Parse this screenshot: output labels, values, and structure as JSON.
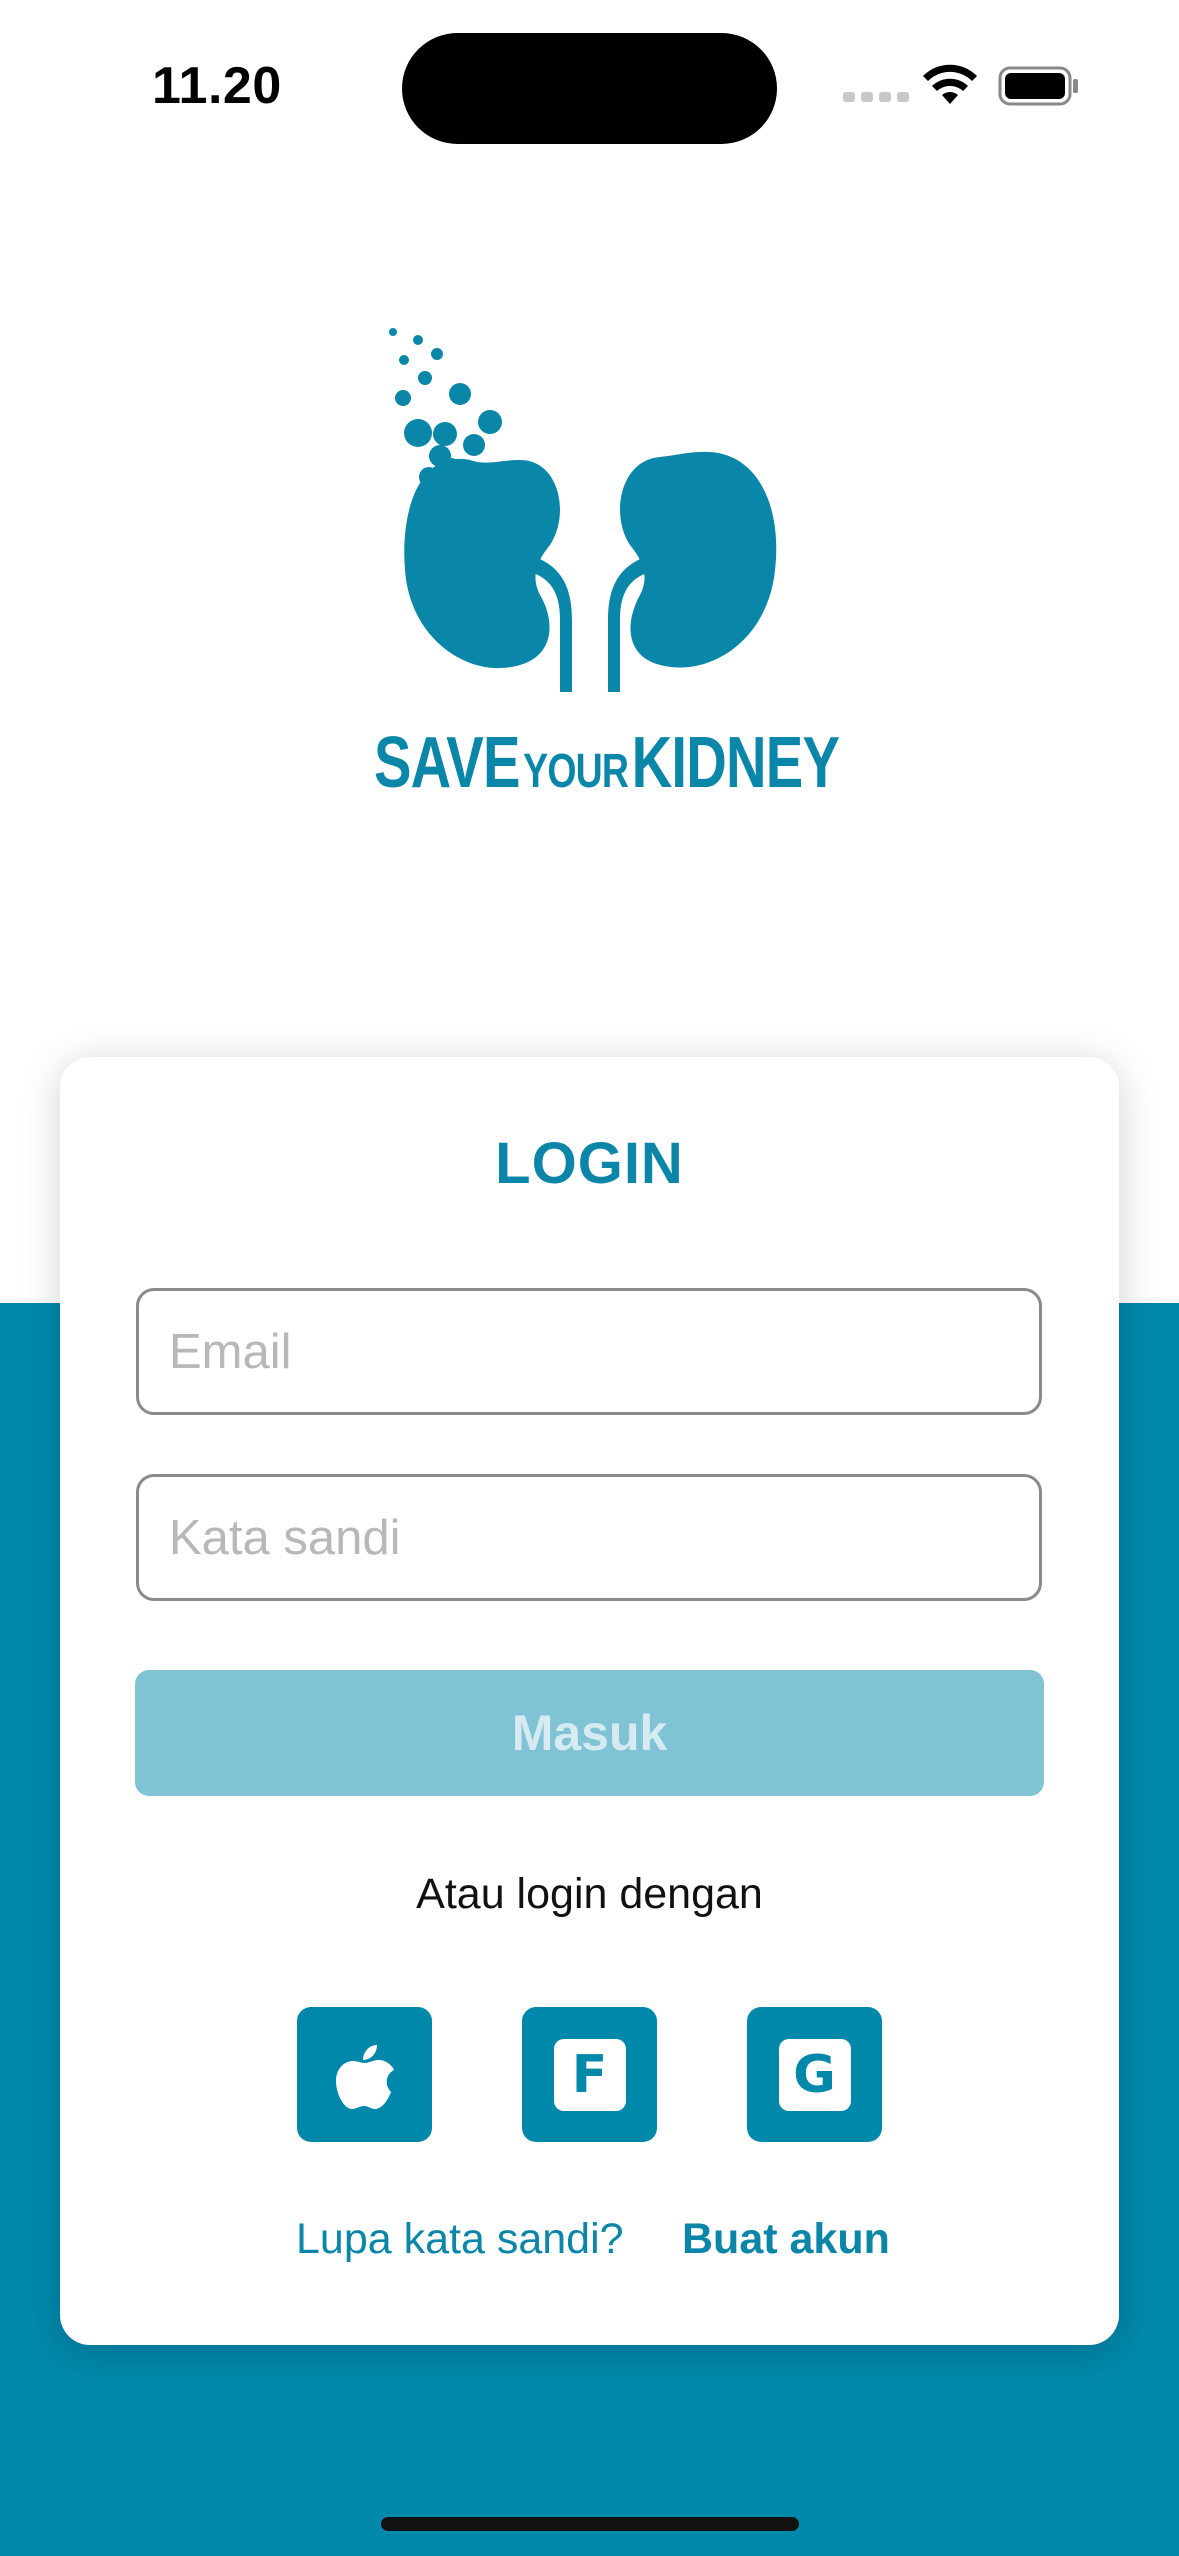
{
  "status_bar": {
    "time": "11.20"
  },
  "brand": {
    "logo_word_1": "SAVE",
    "logo_word_2": "YOUR",
    "logo_word_3": "KIDNEY",
    "primary_color": "#0088ab"
  },
  "login": {
    "title": "LOGIN",
    "email_placeholder": "Email",
    "password_placeholder": "Kata sandi",
    "submit_label": "Masuk",
    "alt_login_text": "Atau login dengan",
    "social": [
      {
        "name": "apple",
        "icon": "apple-icon",
        "glyph": ""
      },
      {
        "name": "facebook",
        "icon": "facebook-icon",
        "glyph": "F"
      },
      {
        "name": "google",
        "icon": "google-icon",
        "glyph": "G"
      }
    ],
    "forgot_password": "Lupa kata sandi?",
    "create_account": "Buat akun"
  }
}
